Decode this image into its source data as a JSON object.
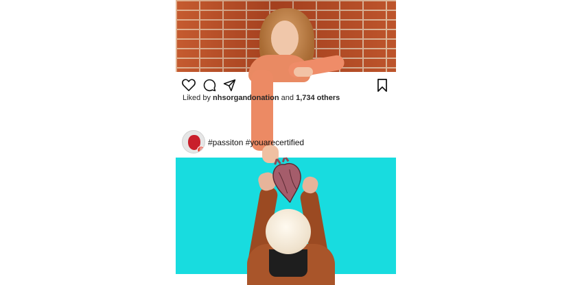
{
  "post_top": {
    "liked_by_prefix": "Liked by",
    "liked_by_user": "nhsorgandonation",
    "and_text": "and",
    "others_count": "1,734 others"
  },
  "post_header": {
    "caption": "#passiton #youarecertified",
    "avatar_badge": "8"
  },
  "icons": {
    "like": "heart-outline-icon",
    "comment": "comment-bubble-icon",
    "share": "paper-plane-icon",
    "save": "bookmark-outline-icon"
  },
  "colors": {
    "brick": "#b24b25",
    "cyan_bg": "#18dcdf",
    "heart_red": "#c91f2b",
    "text_dark": "#262626"
  }
}
